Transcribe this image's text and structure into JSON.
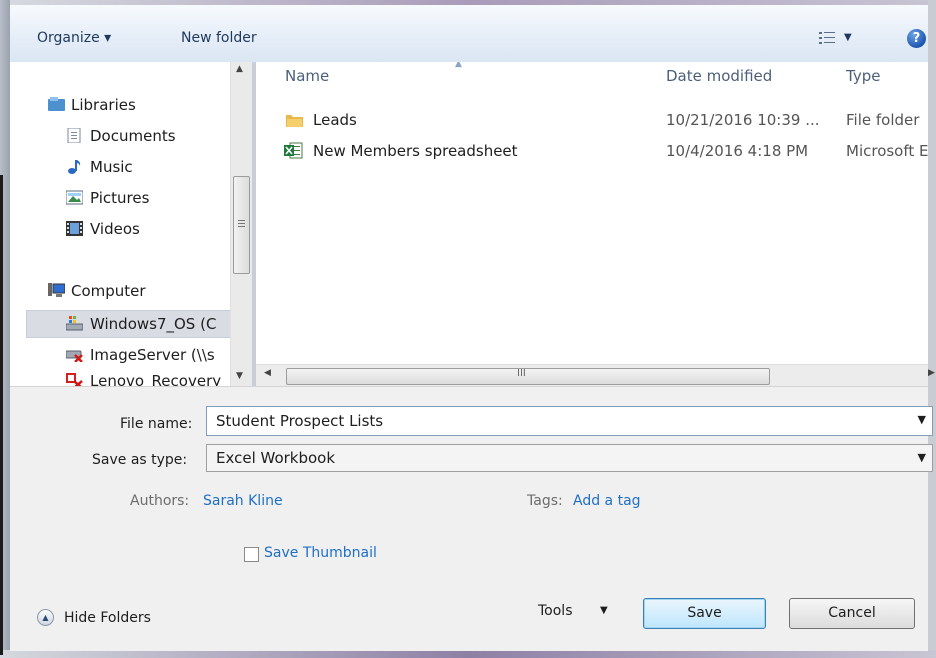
{
  "toolbar": {
    "organize_label": "Organize ▾",
    "new_folder_label": "New folder",
    "view_arrow": "▼",
    "help_glyph": "?"
  },
  "nav": {
    "items": [
      {
        "label": "Libraries",
        "icon": "libraries-icon"
      },
      {
        "label": "Documents",
        "icon": "documents-icon"
      },
      {
        "label": "Music",
        "icon": "music-icon"
      },
      {
        "label": "Pictures",
        "icon": "pictures-icon"
      },
      {
        "label": "Videos",
        "icon": "videos-icon"
      },
      {
        "label": "Computer",
        "icon": "computer-icon"
      },
      {
        "label": "Windows7_OS (C",
        "icon": "drive-icon"
      },
      {
        "label": "ImageServer (\\\\s",
        "icon": "network-drive-icon"
      },
      {
        "label": "Lenovo_Recovery",
        "icon": "recovery-drive-icon"
      }
    ]
  },
  "file_list": {
    "columns": [
      "Name",
      "Date modified",
      "Type"
    ],
    "rows": [
      {
        "name": "Leads",
        "date": "10/21/2016 10:39 ...",
        "type": "File folder",
        "icon": "folder-icon"
      },
      {
        "name": "New Members spreadsheet",
        "date": "10/4/2016 4:18 PM",
        "type": "Microsoft Ex",
        "icon": "excel-file-icon"
      }
    ],
    "hscroll_glyph": "III"
  },
  "form": {
    "file_name_label": "File name:",
    "file_name_value": "Student Prospect Lists",
    "save_type_label": "Save as type:",
    "save_type_value": "Excel Workbook",
    "authors_label": "Authors:",
    "authors_value": "Sarah Kline",
    "tags_label": "Tags:",
    "tags_value": "Add a tag",
    "thumbnail_label": "Save Thumbnail",
    "thumbnail_checked": false
  },
  "footer": {
    "hide_folders_label": "Hide Folders",
    "tools_label": "Tools",
    "save_label": "Save",
    "cancel_label": "Cancel"
  },
  "colors": {
    "link": "#1f6fc5",
    "toolbar_text": "#1e395b"
  }
}
